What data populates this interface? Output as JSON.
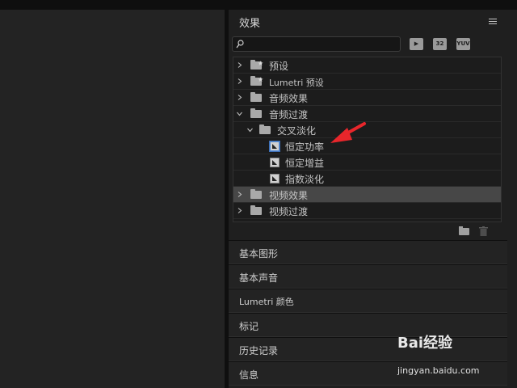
{
  "panel": {
    "title": "效果"
  },
  "search": {
    "value": "",
    "placeholder": ""
  },
  "toolbar_badges": [
    "32",
    "YUV"
  ],
  "tree": [
    {
      "label": "预设",
      "expanded": false,
      "kind": "folder-star",
      "level": 0
    },
    {
      "label": "Lumetri 预设",
      "expanded": false,
      "kind": "folder-star",
      "level": 0
    },
    {
      "label": "音频效果",
      "expanded": false,
      "kind": "folder",
      "level": 0
    },
    {
      "label": "音频过渡",
      "expanded": true,
      "kind": "folder",
      "level": 0
    },
    {
      "label": "交叉淡化",
      "expanded": true,
      "kind": "folder",
      "level": 1
    },
    {
      "label": "恒定功率",
      "kind": "effect",
      "level": 2,
      "highlighted": true
    },
    {
      "label": "恒定增益",
      "kind": "effect",
      "level": 2
    },
    {
      "label": "指数淡化",
      "kind": "effect",
      "level": 2
    },
    {
      "label": "视频效果",
      "expanded": false,
      "kind": "folder",
      "level": 0,
      "selected": true
    },
    {
      "label": "视频过渡",
      "expanded": false,
      "kind": "folder",
      "level": 0
    }
  ],
  "sections": [
    {
      "label": "基本图形"
    },
    {
      "label": "基本声音"
    },
    {
      "label": "Lumetri 颜色"
    },
    {
      "label": "标记"
    },
    {
      "label": "历史记录"
    },
    {
      "label": "信息"
    }
  ],
  "watermark": {
    "brand": "Bai经验",
    "url": "jingyan.baidu.com"
  },
  "colors": {
    "annotation_arrow": "#e8262b",
    "selection": "#474747"
  }
}
